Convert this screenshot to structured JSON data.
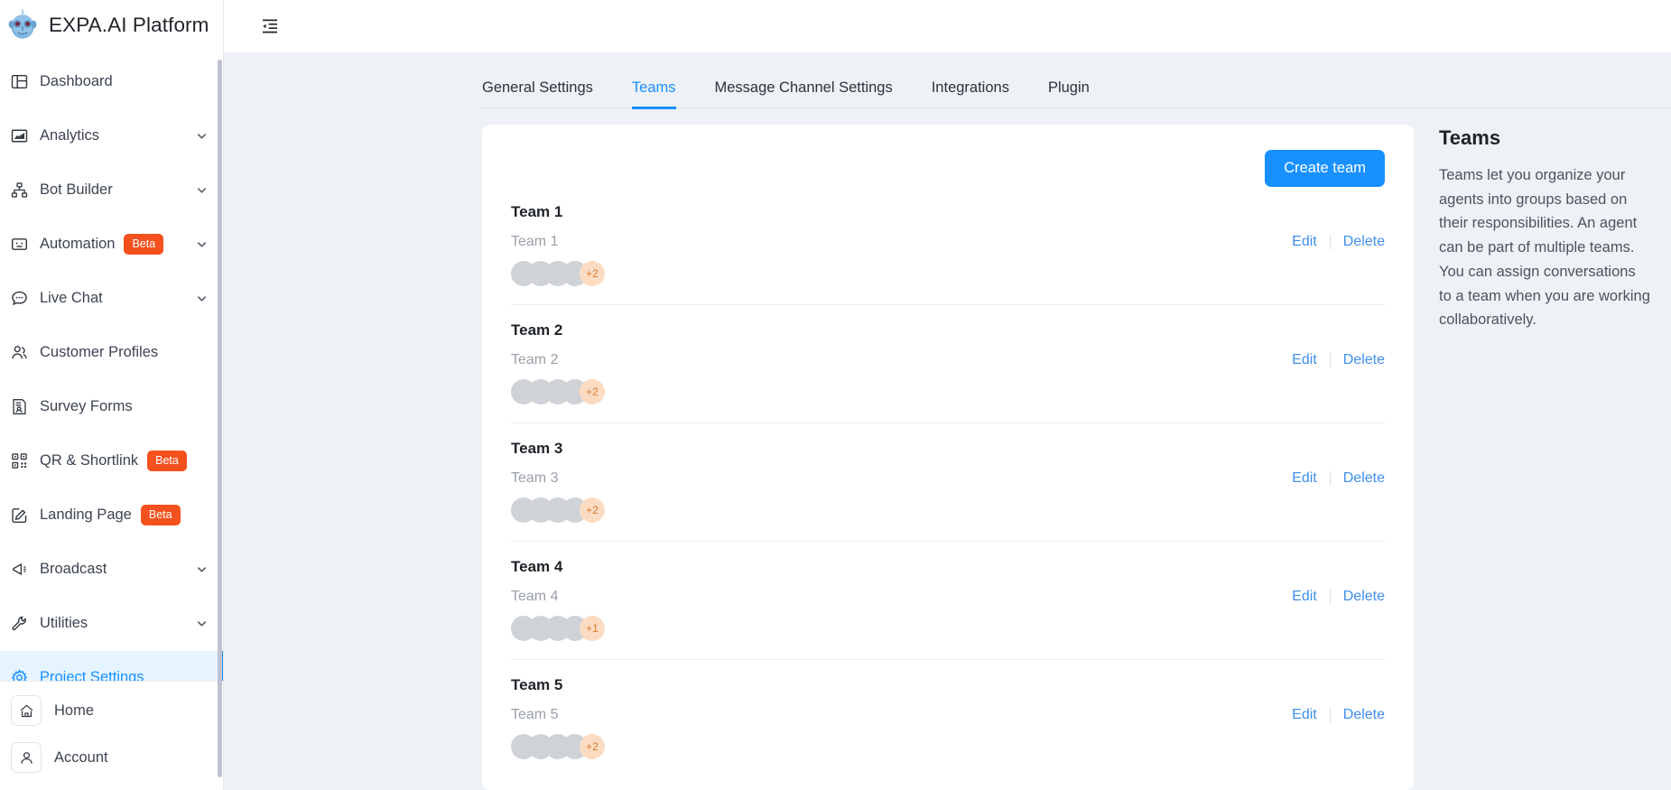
{
  "brand": {
    "title": "EXPA.AI Platform",
    "logo_icon": "robot-head-icon"
  },
  "sidebar": {
    "items": [
      {
        "label": "Dashboard",
        "icon": "dashboard-icon",
        "badge": null,
        "chevron": false,
        "active": false
      },
      {
        "label": "Analytics",
        "icon": "analytics-chart-icon",
        "badge": null,
        "chevron": true,
        "active": false
      },
      {
        "label": "Bot Builder",
        "icon": "sitemap-icon",
        "badge": null,
        "chevron": true,
        "active": false
      },
      {
        "label": "Automation",
        "icon": "robot-face-icon",
        "badge": "Beta",
        "chevron": true,
        "active": false
      },
      {
        "label": "Live Chat",
        "icon": "chat-bubble-icon",
        "badge": null,
        "chevron": true,
        "active": false
      },
      {
        "label": "Customer Profiles",
        "icon": "people-icon",
        "badge": null,
        "chevron": false,
        "active": false
      },
      {
        "label": "Survey Forms",
        "icon": "survey-form-icon",
        "badge": null,
        "chevron": false,
        "active": false
      },
      {
        "label": "QR & Shortlink",
        "icon": "qr-code-icon",
        "badge": "Beta",
        "chevron": false,
        "active": false
      },
      {
        "label": "Landing Page",
        "icon": "pencil-square-icon",
        "badge": "Beta",
        "chevron": false,
        "active": false
      },
      {
        "label": "Broadcast",
        "icon": "megaphone-icon",
        "badge": null,
        "chevron": true,
        "active": false
      },
      {
        "label": "Utilities",
        "icon": "wrench-icon",
        "badge": null,
        "chevron": true,
        "active": false
      },
      {
        "label": "Project Settings",
        "icon": "gear-icon",
        "badge": null,
        "chevron": false,
        "active": true
      }
    ],
    "footer_items": [
      {
        "label": "Home",
        "icon": "home-icon"
      },
      {
        "label": "Account",
        "icon": "user-icon"
      }
    ]
  },
  "topbar": {
    "collapse_icon": "collapse-sidebar-icon"
  },
  "tabs": [
    {
      "label": "General Settings",
      "active": false
    },
    {
      "label": "Teams",
      "active": true
    },
    {
      "label": "Message Channel Settings",
      "active": false
    },
    {
      "label": "Integrations",
      "active": false
    },
    {
      "label": "Plugin",
      "active": false
    }
  ],
  "main": {
    "create_button": "Create team",
    "edit_label": "Edit",
    "delete_label": "Delete",
    "teams": [
      {
        "name": "Team 1",
        "description": "Team 1",
        "avatar_count": 4,
        "extra_members": "+2"
      },
      {
        "name": "Team 2",
        "description": "Team 2",
        "avatar_count": 4,
        "extra_members": "+2"
      },
      {
        "name": "Team 3",
        "description": "Team 3",
        "avatar_count": 4,
        "extra_members": "+2"
      },
      {
        "name": "Team 4",
        "description": "Team 4",
        "avatar_count": 4,
        "extra_members": "+1"
      },
      {
        "name": "Team 5",
        "description": "Team 5",
        "avatar_count": 4,
        "extra_members": "+2"
      }
    ]
  },
  "aside": {
    "title": "Teams",
    "text": "Teams let you organize your agents into groups based on their responsibilities. An agent can be part of multiple teams. You can assign conversations to a team when you are working collaboratively."
  },
  "colors": {
    "accent_blue": "#1890ff",
    "link_blue": "#3f8fe8",
    "beta_orange": "#f4511e",
    "active_nav_bg": "#e6f4ff",
    "workspace_bg": "#eef1f6",
    "avatar_gray": "#cfd2d6",
    "avatar_more_bg": "#fbdcc3",
    "avatar_more_text": "#d97b2e"
  }
}
